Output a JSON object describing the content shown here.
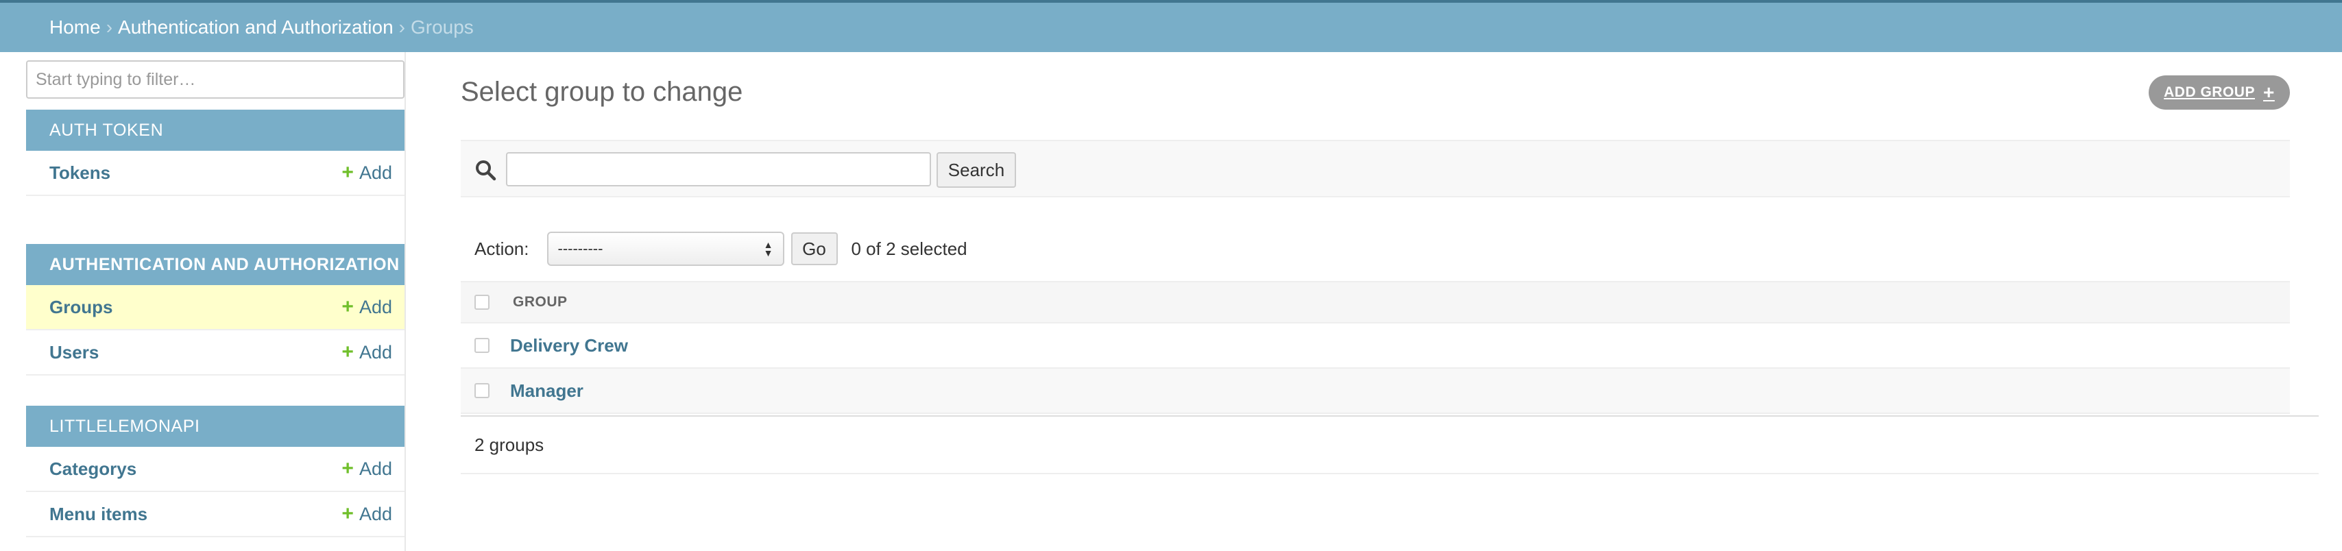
{
  "breadcrumbs": {
    "home": "Home",
    "separator": "›",
    "section": "Authentication and Authorization",
    "current": "Groups"
  },
  "sidebar": {
    "filter_placeholder": "Start typing to filter…",
    "add_label": "Add",
    "modules": [
      {
        "title": "Auth Token",
        "rows": [
          {
            "label": "Tokens"
          }
        ]
      },
      {
        "title": "Authentication and Authorization",
        "rows": [
          {
            "label": "Groups"
          },
          {
            "label": "Users"
          }
        ]
      },
      {
        "title": "Littlelemonapi",
        "rows": [
          {
            "label": "Categorys"
          },
          {
            "label": "Menu items"
          }
        ]
      }
    ]
  },
  "main": {
    "title": "Select group to change",
    "add_button": "Add group",
    "search_button": "Search",
    "search_value": "",
    "action_label": "Action:",
    "action_selected": "---------",
    "go_button": "Go",
    "selected_count": "0 of 2 selected",
    "column_header": "Group",
    "rows": [
      {
        "name": "Delivery Crew"
      },
      {
        "name": "Manager"
      }
    ],
    "result_count": "2 groups"
  },
  "colors": {
    "header_bg": "#79aec8",
    "top_line": "#417690",
    "link": "#417690",
    "add_plus": "#70bf2b",
    "current_row": "#ffffcc"
  },
  "icons": {
    "search": "search-icon",
    "plus": "plus-icon",
    "select_arrows": "updown-arrows-icon"
  }
}
